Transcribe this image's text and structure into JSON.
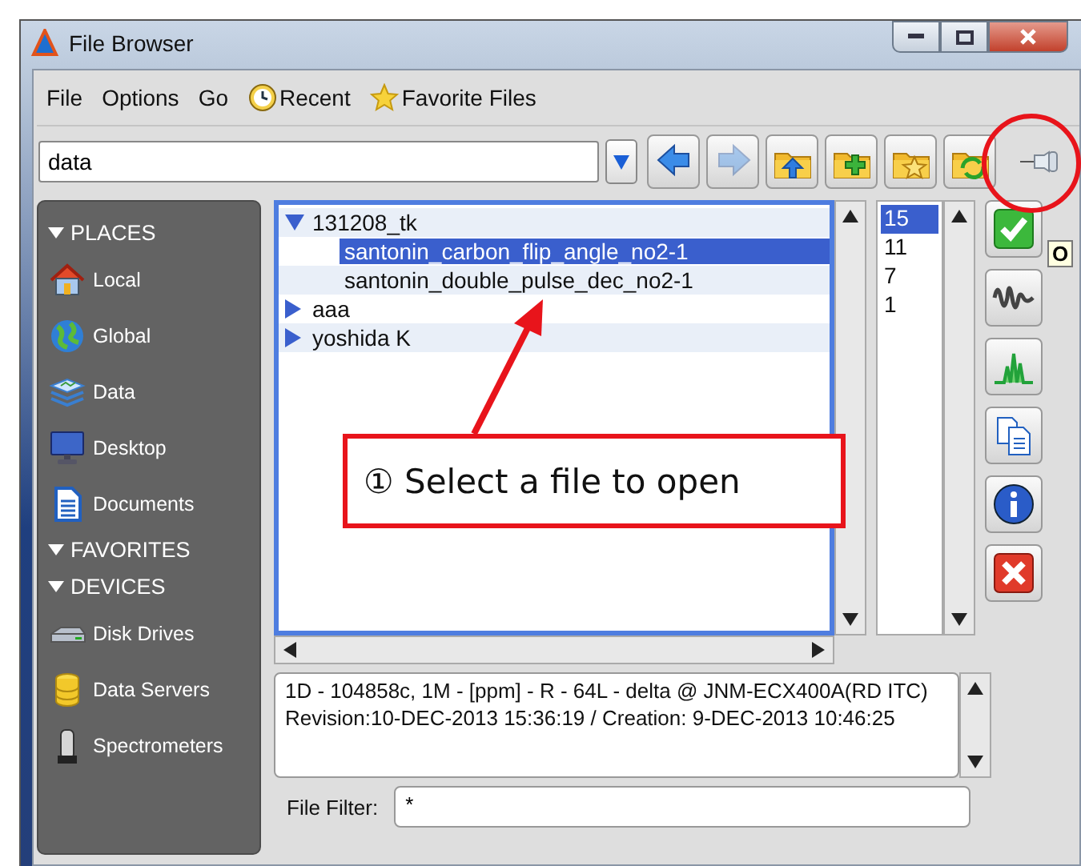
{
  "window": {
    "title": "File Browser"
  },
  "menu": [
    {
      "label": "File",
      "kind": "plain"
    },
    {
      "label": "Options",
      "kind": "plain"
    },
    {
      "label": "Go",
      "kind": "plain"
    },
    {
      "label": "Recent",
      "kind": "clock"
    },
    {
      "label": "Favorite Files",
      "kind": "star"
    }
  ],
  "path_field": {
    "value": "data"
  },
  "toolbar": [
    {
      "kind": "back",
      "disabled": false
    },
    {
      "kind": "forward",
      "disabled": true
    },
    {
      "kind": "folder-up",
      "disabled": false
    },
    {
      "kind": "folder-new",
      "disabled": false
    },
    {
      "kind": "folder-star",
      "disabled": false
    },
    {
      "kind": "folder-refresh",
      "disabled": false
    },
    {
      "kind": "pin",
      "disabled": false
    }
  ],
  "sidebar": [
    {
      "label": "PLACES",
      "expanded": true,
      "items": [
        {
          "label": "Local"
        },
        {
          "label": "Global"
        },
        {
          "label": "Data"
        },
        {
          "label": "Desktop"
        },
        {
          "label": "Documents"
        }
      ]
    },
    {
      "label": "FAVORITES",
      "expanded": true
    },
    {
      "label": "DEVICES",
      "expanded": true,
      "items": [
        {
          "label": "Disk Drives"
        },
        {
          "label": "Data Servers"
        },
        {
          "label": "Spectrometers"
        }
      ]
    }
  ],
  "tree": [
    {
      "label": "131208_tk",
      "expanded": true,
      "selected": false,
      "children": [
        {
          "label": "santonin_carbon_flip_angle_no2-1",
          "selected": true
        },
        {
          "label": "santonin_double_pulse_dec_no2-1",
          "selected": false
        }
      ]
    },
    {
      "label": "aaa",
      "expanded": false,
      "selected": false
    },
    {
      "label": "yoshida K",
      "expanded": false,
      "selected": false
    }
  ],
  "counts": [
    {
      "text": "15",
      "selected": true
    },
    {
      "text": "11",
      "selected": false
    },
    {
      "text": "7",
      "selected": false
    },
    {
      "text": "1",
      "selected": false
    }
  ],
  "side_buttons": [
    {
      "kind": "ok"
    },
    {
      "kind": "fid"
    },
    {
      "kind": "spectrum"
    },
    {
      "kind": "copy"
    },
    {
      "kind": "info"
    },
    {
      "kind": "cancel"
    }
  ],
  "tooltip": "O",
  "info": [
    "1D - 104858c, 1M - [ppm] - R - 64L - delta @ JNM-ECX400A(RD ITC)",
    "Revision:10-DEC-2013 15:36:19 / Creation: 9-DEC-2013 10:46:25"
  ],
  "filter": {
    "label": "File Filter:",
    "value": "*"
  },
  "annotation": {
    "text": "① Select a file to open"
  }
}
